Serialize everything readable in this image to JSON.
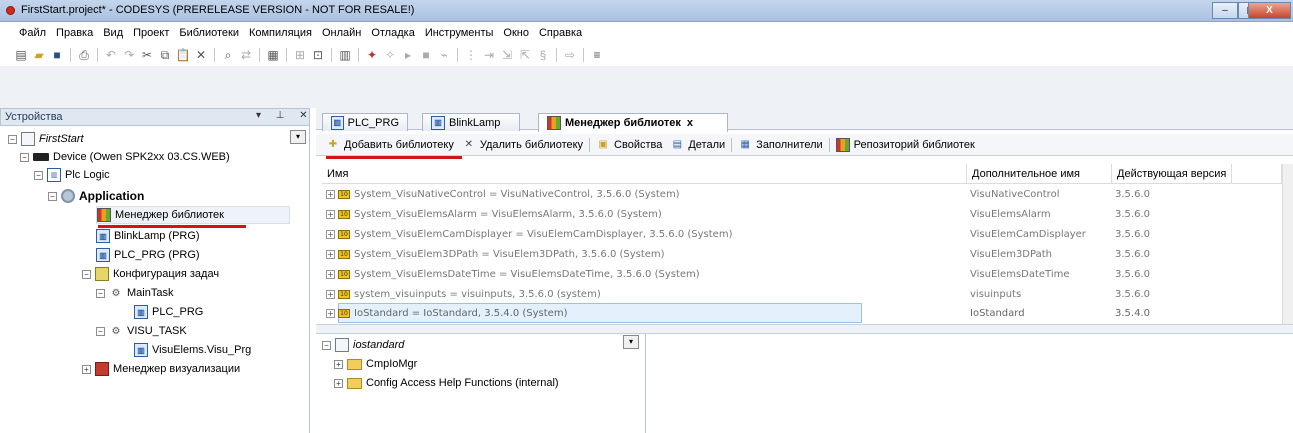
{
  "window": {
    "title": "FirstStart.project* - CODESYS (PRERELEASE VERSION - NOT FOR RESALE!)",
    "minimize": "–",
    "maximize": "▢",
    "close": "X"
  },
  "menu": [
    "Файл",
    "Правка",
    "Вид",
    "Проект",
    "Библиотеки",
    "Компиляция",
    "Онлайн",
    "Отладка",
    "Инструменты",
    "Окно",
    "Справка"
  ],
  "left_panel": {
    "title": "Устройства",
    "header_icons": "▾ ⊥ ✕",
    "tree": {
      "project": "FirstStart",
      "device": "Device (Owen SPK2xx 03.CS.WEB)",
      "plc_logic": "Plc Logic",
      "application": "Application",
      "library_manager": "Менеджер библиотек",
      "blinklamp": "BlinkLamp (PRG)",
      "plc_prg": "PLC_PRG (PRG)",
      "task_config": "Конфигурация задач",
      "main_task": "MainTask",
      "main_task_prog": "PLC_PRG",
      "visu_task": "VISU_TASK",
      "visu_task_prog": "VisuElems.Visu_Prg",
      "visu_manager": "Менеджер визуализации"
    }
  },
  "editor": {
    "tabs": [
      "PLC_PRG",
      "BlinkLamp",
      "Менеджер библиотек"
    ],
    "active_tab_close": "x",
    "toolbar": {
      "add_library": "Добавить библиотеку",
      "remove_library": "Удалить библиотеку",
      "properties": "Свойства",
      "details": "Детали",
      "placeholders": "Заполнители",
      "library_repository": "Репозиторий библиотек"
    },
    "table": {
      "columns": [
        "Имя",
        "Дополнительное имя",
        "Действующая версия"
      ],
      "rows": [
        {
          "name": "System_VisuNativeControl = VisuNativeControl, 3.5.6.0 (System)",
          "alias": "VisuNativeControl",
          "version": "3.5.6.0"
        },
        {
          "name": "System_VisuElemsAlarm = VisuElemsAlarm, 3.5.6.0 (System)",
          "alias": "VisuElemsAlarm",
          "version": "3.5.6.0"
        },
        {
          "name": "System_VisuElemCamDisplayer = VisuElemCamDisplayer, 3.5.6.0 (System)",
          "alias": "VisuElemCamDisplayer",
          "version": "3.5.6.0"
        },
        {
          "name": "System_VisuElem3DPath = VisuElem3DPath, 3.5.6.0 (System)",
          "alias": "VisuElem3DPath",
          "version": "3.5.6.0"
        },
        {
          "name": "System_VisuElemsDateTime = VisuElemsDateTime, 3.5.6.0 (System)",
          "alias": "VisuElemsDateTime",
          "version": "3.5.6.0"
        },
        {
          "name": "system_visuinputs = visuinputs, 3.5.6.0 (system)",
          "alias": "visuinputs",
          "version": "3.5.6.0"
        },
        {
          "name": "IoStandard = IoStandard, 3.5.4.0 (System)",
          "alias": "IoStandard",
          "version": "3.5.4.0"
        }
      ]
    },
    "bottom_tree": {
      "root": "iostandard",
      "items": [
        "CmpIoMgr",
        "Config Access Help Functions (internal)"
      ]
    }
  },
  "colors": {
    "accent_red": "#d41414",
    "selection": "#e4f0fb"
  }
}
